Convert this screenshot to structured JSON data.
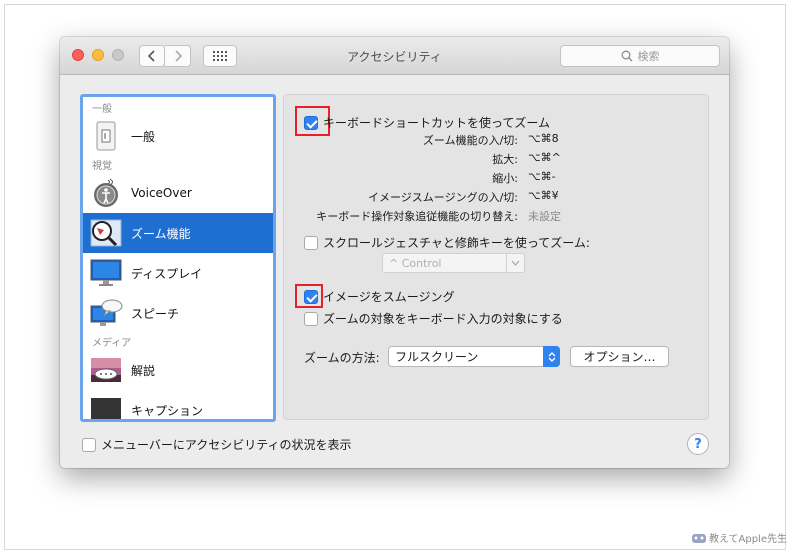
{
  "window": {
    "title": "アクセシビリティ"
  },
  "search": {
    "placeholder": "検索",
    "icon": "search-icon"
  },
  "sidebar": {
    "categories": [
      "一般",
      "視覚",
      "メディア"
    ],
    "items": [
      {
        "label": "一般",
        "icon": "general-switch-icon"
      },
      {
        "label": "VoiceOver",
        "icon": "voiceover-icon"
      },
      {
        "label": "ズーム機能",
        "icon": "zoom-magnifier-icon",
        "selected": true
      },
      {
        "label": "ディスプレイ",
        "icon": "display-icon"
      },
      {
        "label": "スピーチ",
        "icon": "speech-icon"
      },
      {
        "label": "解説",
        "icon": "descriptions-icon"
      },
      {
        "label": "キャプション",
        "icon": "captions-icon"
      }
    ]
  },
  "zoom": {
    "keyboard_shortcuts": {
      "label": "キーボードショートカットを使ってズーム",
      "checked": true
    },
    "shortcuts": [
      {
        "label": "ズーム機能の入/切:",
        "value": "⌥⌘8"
      },
      {
        "label": "拡大:",
        "value": "⌥⌘^"
      },
      {
        "label": "縮小:",
        "value": "⌥⌘-"
      },
      {
        "label": "イメージスムージングの入/切:",
        "value": "⌥⌘¥"
      },
      {
        "label": "キーボード操作対象追従機能の切り替え:",
        "value": "未設定"
      }
    ],
    "scroll_gesture": {
      "label": "スクロールジェスチャと修飾キーを使ってズーム:",
      "checked": false
    },
    "modifier_select": {
      "value": "^ Control",
      "enabled": false
    },
    "smooth_images": {
      "label": "イメージをスムージング",
      "checked": true
    },
    "follow_focus": {
      "label": "ズームの対象をキーボード入力の対象にする",
      "checked": false
    },
    "zoom_style": {
      "label": "ズームの方法:",
      "value": "フルスクリーン"
    },
    "options_button": "オプション…"
  },
  "footer": {
    "show_in_menubar": {
      "label": "メニューバーにアクセシビリティの状況を表示",
      "checked": false
    },
    "help": "?"
  },
  "watermark": "教えてApple先生",
  "colors": {
    "accent": "#2e83f0",
    "selection": "#1e6fd1",
    "highlight_box": "#e5222a"
  }
}
